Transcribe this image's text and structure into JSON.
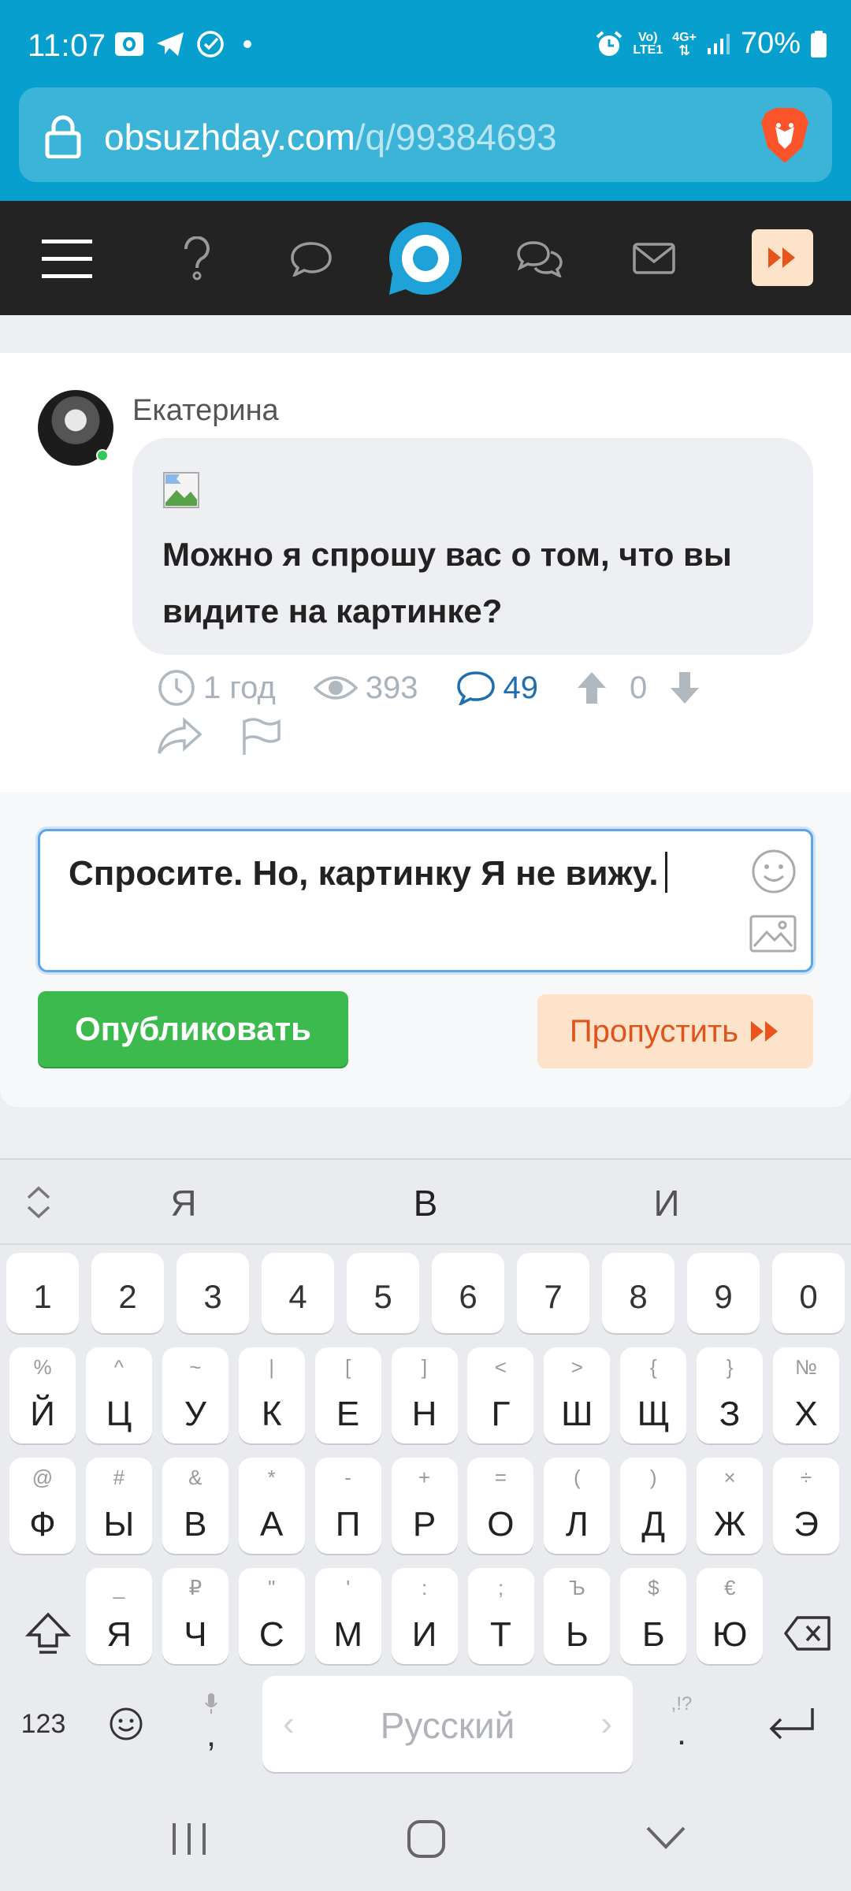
{
  "status_bar": {
    "time": "11:07",
    "battery": "70%",
    "signal_labels": [
      "Vo)",
      "LTE1",
      "4G+"
    ],
    "icons": [
      "outlook-icon",
      "telegram-icon",
      "check-circle-icon",
      "dot-icon",
      "alarm-icon",
      "signal-icon",
      "battery-icon"
    ]
  },
  "browser": {
    "url_host": "obsuzhday.com",
    "url_path": "/q/99384693",
    "icons": [
      "lock-icon",
      "brave-lion-icon"
    ]
  },
  "site_nav": {
    "items": [
      "menu-icon",
      "question-icon",
      "comment-icon",
      "logo-icon",
      "comments-icon",
      "mail-icon",
      "skip-icon"
    ]
  },
  "question": {
    "author": "Екатерина",
    "text": "Можно я спрошу вас о том, что вы видите на картинке?",
    "age": "1 год",
    "views": "393",
    "comments": "49",
    "votes": "0"
  },
  "answer": {
    "text": "Спросите. Но, картинку Я не вижу.",
    "publish_label": "Опубликовать",
    "skip_label": "Пропустить"
  },
  "keyboard": {
    "suggestions": [
      "Я",
      "В",
      "И"
    ],
    "numbers": [
      "1",
      "2",
      "3",
      "4",
      "5",
      "6",
      "7",
      "8",
      "9",
      "0"
    ],
    "row1": [
      {
        "main": "Й",
        "sub": "%"
      },
      {
        "main": "Ц",
        "sub": "^"
      },
      {
        "main": "У",
        "sub": "~"
      },
      {
        "main": "К",
        "sub": "|"
      },
      {
        "main": "Е",
        "sub": "["
      },
      {
        "main": "Н",
        "sub": "]"
      },
      {
        "main": "Г",
        "sub": "<"
      },
      {
        "main": "Ш",
        "sub": ">"
      },
      {
        "main": "Щ",
        "sub": "{"
      },
      {
        "main": "З",
        "sub": "}"
      },
      {
        "main": "Х",
        "sub": "№"
      }
    ],
    "row2": [
      {
        "main": "Ф",
        "sub": "@"
      },
      {
        "main": "Ы",
        "sub": "#"
      },
      {
        "main": "В",
        "sub": "&"
      },
      {
        "main": "А",
        "sub": "*"
      },
      {
        "main": "П",
        "sub": "-"
      },
      {
        "main": "Р",
        "sub": "+"
      },
      {
        "main": "О",
        "sub": "="
      },
      {
        "main": "Л",
        "sub": "("
      },
      {
        "main": "Д",
        "sub": ")"
      },
      {
        "main": "Ж",
        "sub": "×"
      },
      {
        "main": "Э",
        "sub": "÷"
      }
    ],
    "row3": [
      {
        "main": "Я",
        "sub": "_"
      },
      {
        "main": "Ч",
        "sub": "₽"
      },
      {
        "main": "С",
        "sub": "\""
      },
      {
        "main": "М",
        "sub": "'"
      },
      {
        "main": "И",
        "sub": ":"
      },
      {
        "main": "Т",
        "sub": ";"
      },
      {
        "main": "Ь",
        "sub": "Ъ"
      },
      {
        "main": "Б",
        "sub": "$"
      },
      {
        "main": "Ю",
        "sub": "€"
      }
    ],
    "num_mode_label": "123",
    "comma": ",",
    "period": ".",
    "period_sub": ",!?",
    "space_label": "Русский"
  }
}
